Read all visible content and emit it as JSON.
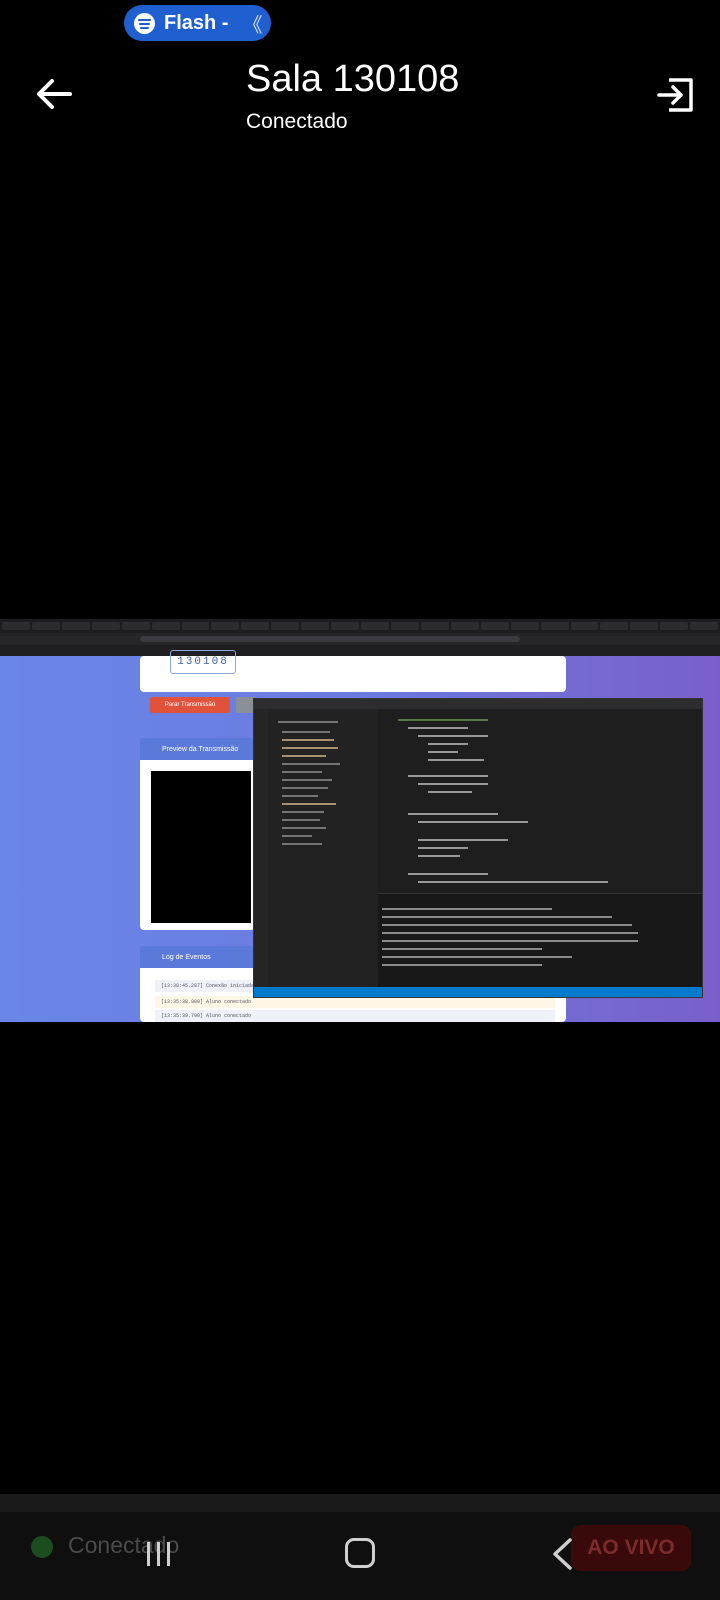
{
  "status_pill": {
    "label": "Flash -",
    "chevron": "《",
    "icon": "spotify-icon"
  },
  "header": {
    "title": "Sala 130108",
    "subtitle": "Conectado",
    "back_icon": "arrow-left-icon",
    "exit_icon": "exit-icon"
  },
  "shared_screen": {
    "room_code": "130108",
    "stop_button": "Parar Transmissão",
    "preview_title": "Preview da Transmissão",
    "log_title": "Log de Eventos",
    "log_lines": [
      "[13:38:45.287] Conexão iniciada",
      "[13:35:38.909] Aluno conectado",
      "[13:35:39.790] Aluno conectado"
    ]
  },
  "footer": {
    "connection_label": "Conectado",
    "live_button": "AO VIVO",
    "nav_recent_icon": "recent-apps-icon",
    "nav_home_icon": "home-icon",
    "nav_back_icon": "back-icon"
  },
  "colors": {
    "pill": "#1f5fd0",
    "live_button_bg": "#3a0a0a",
    "connection_dot": "#1b4d1f"
  }
}
